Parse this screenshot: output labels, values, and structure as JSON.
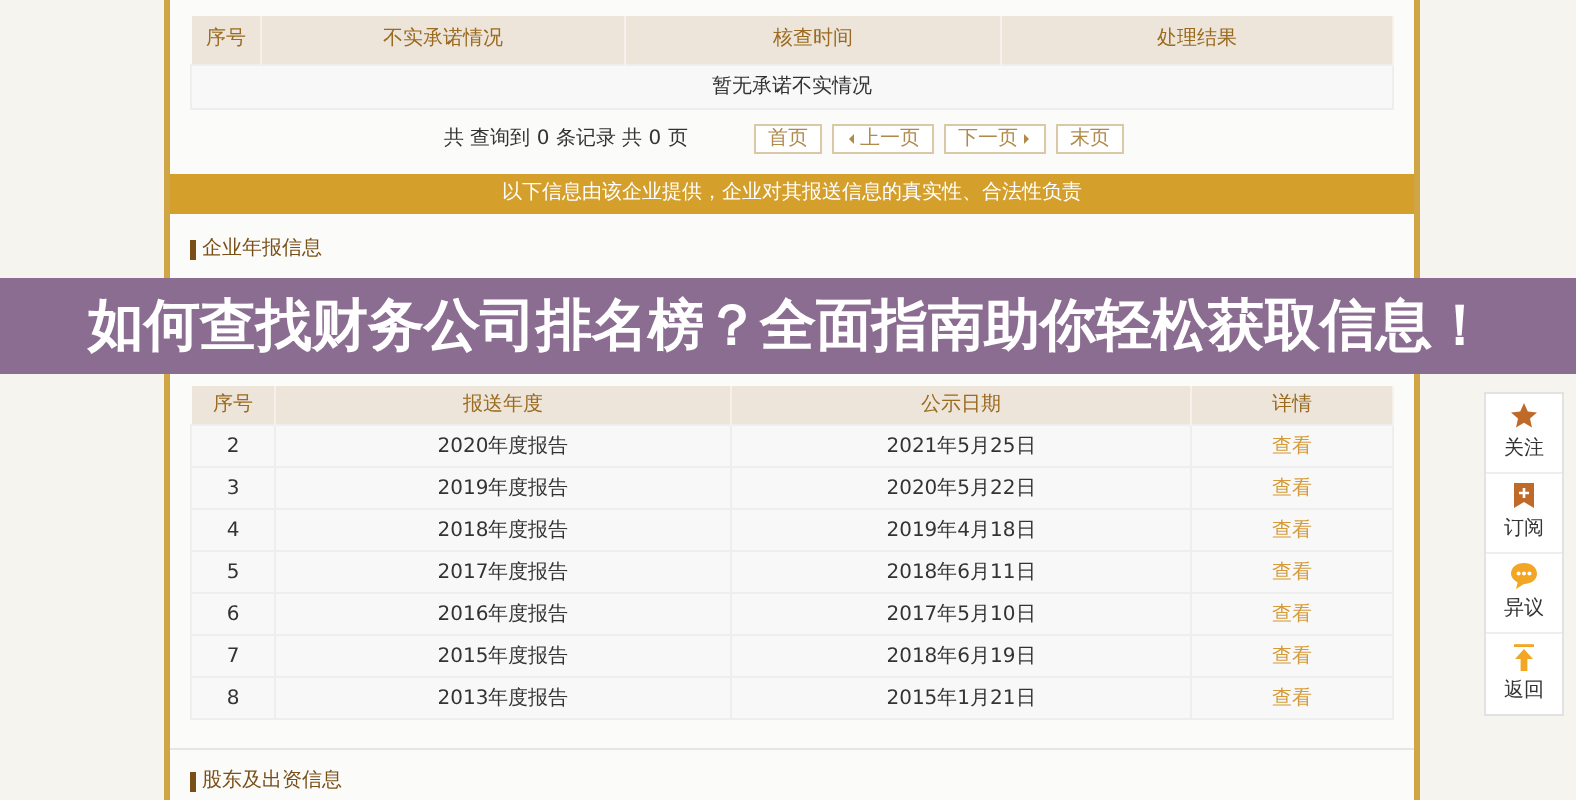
{
  "disclosure_table": {
    "columns": [
      "序号",
      "不实承诺情况",
      "核查时间",
      "处理结果"
    ],
    "empty_message": "暂无承诺不实情况"
  },
  "pagination": {
    "summary": "共 查询到 0 条记录 共 0 页",
    "buttons": [
      {
        "label": "首页",
        "kind": "plain"
      },
      {
        "label": "上一页",
        "kind": "prev"
      },
      {
        "label": "下一页",
        "kind": "next"
      },
      {
        "label": "末页",
        "kind": "plain"
      }
    ]
  },
  "notice": "以下信息由该企业提供，企业对其报送信息的真实性、合法性负责",
  "annual_reports": {
    "title": "企业年报信息",
    "columns": [
      "序号",
      "报送年度",
      "公示日期",
      "详情"
    ],
    "rows": [
      {
        "index": "2",
        "year": "2020年度报告",
        "date": "2021年5月25日",
        "detail": "查看"
      },
      {
        "index": "3",
        "year": "2019年度报告",
        "date": "2020年5月22日",
        "detail": "查看"
      },
      {
        "index": "4",
        "year": "2018年度报告",
        "date": "2019年4月18日",
        "detail": "查看"
      },
      {
        "index": "5",
        "year": "2017年度报告",
        "date": "2018年6月11日",
        "detail": "查看"
      },
      {
        "index": "6",
        "year": "2016年度报告",
        "date": "2017年5月10日",
        "detail": "查看"
      },
      {
        "index": "7",
        "year": "2015年度报告",
        "date": "2018年6月19日",
        "detail": "查看"
      },
      {
        "index": "8",
        "year": "2013年度报告",
        "date": "2015年1月21日",
        "detail": "查看"
      }
    ]
  },
  "shareholders": {
    "title": "股东及出资信息"
  },
  "overlay_title": "如何查找财务公司排名榜？全面指南助你轻松获取信息！",
  "side_tools": [
    {
      "label": "关注",
      "kind": "star"
    },
    {
      "label": "订阅",
      "kind": "bookmark"
    },
    {
      "label": "异议",
      "kind": "chat"
    },
    {
      "label": "返回",
      "kind": "up"
    }
  ]
}
